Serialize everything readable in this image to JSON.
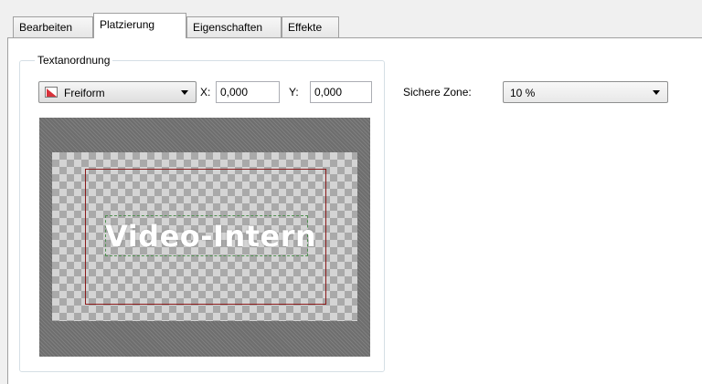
{
  "tabs": [
    {
      "label": "Bearbeiten",
      "active": false
    },
    {
      "label": "Platzierung",
      "active": true
    },
    {
      "label": "Eigenschaften",
      "active": false
    },
    {
      "label": "Effekte",
      "active": false
    }
  ],
  "textanordnung": {
    "group_title": "Textanordnung",
    "mode_select": {
      "value": "Freiform",
      "icon": "freeform-icon"
    },
    "x_label": "X:",
    "x_value": "0,000",
    "y_label": "Y:",
    "y_value": "0,000"
  },
  "safe_zone": {
    "label": "Sichere Zone:",
    "value": "10 %"
  },
  "preview": {
    "text": "Video-Intern",
    "safe_zone_color": "#8b1c1c",
    "text_frame_color": "#4f8f4f"
  }
}
